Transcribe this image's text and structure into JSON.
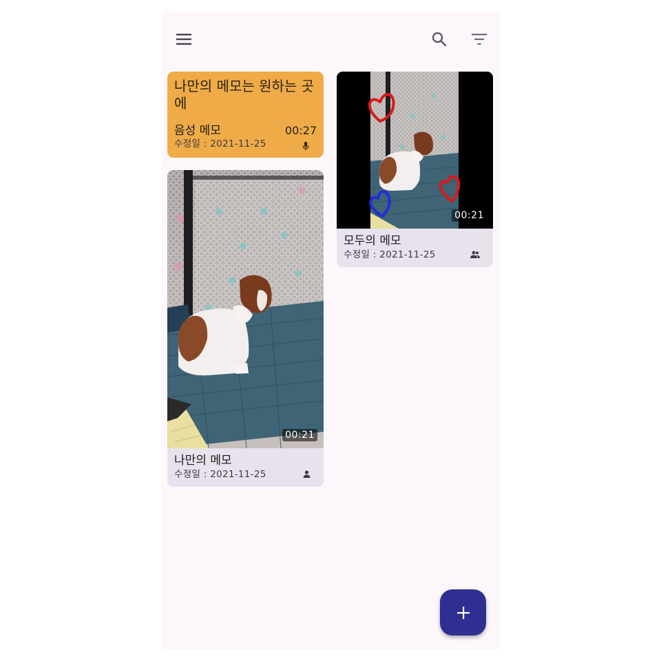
{
  "topbar": {
    "menu_icon": "hamburger-menu-icon",
    "search_icon": "search-icon",
    "filter_icon": "filter-icon"
  },
  "notes": [
    {
      "kind": "voice",
      "body": "나만의 메모는 원하는 곳에",
      "title": "음성 메모",
      "date": "수정일 : 2021-11-25",
      "duration": "00:27",
      "icon": "mic-icon",
      "color": "#eeab47"
    },
    {
      "kind": "video",
      "title": "나만의 메모",
      "date": "수정일 : 2021-11-25",
      "duration": "00:21",
      "icon": "person-icon"
    },
    {
      "kind": "video",
      "title": "모두의 메모",
      "date": "수정일 : 2021-11-25",
      "duration": "00:21",
      "icon": "group-icon"
    }
  ],
  "fab": {
    "icon": "plus-icon",
    "color": "#2f2e91"
  }
}
